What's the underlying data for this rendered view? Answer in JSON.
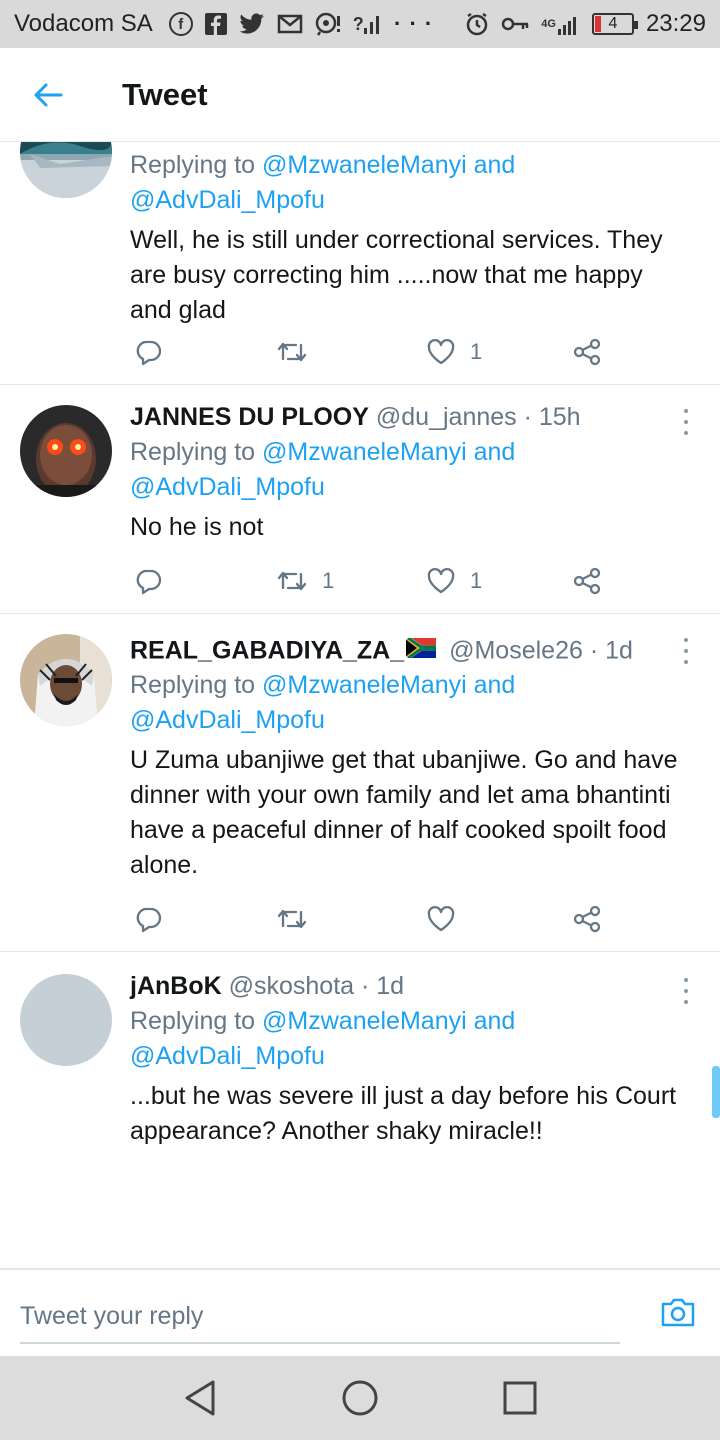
{
  "status_bar": {
    "carrier": "Vodacom SA",
    "signal_text": "?",
    "network_type": "4G",
    "battery_level": "4",
    "time": "23:29"
  },
  "header": {
    "title": "Tweet"
  },
  "tweets": [
    {
      "name": "",
      "handle": "",
      "time": "",
      "replying_prefix": "Replying to ",
      "reply_mention_1": "@MzwaneleManyi",
      "reply_and": " and",
      "reply_mention_2": "@AdvDali_Mpofu",
      "text": "Well, he is still under correctional services. They are busy correcting him .....now that me happy and glad",
      "retweets": "",
      "likes": "1"
    },
    {
      "name": "JANNES DU PLOOY",
      "handle": "@du_jannes",
      "time": "15h",
      "replying_prefix": "Replying to ",
      "reply_mention_1": "@MzwaneleManyi",
      "reply_and": " and",
      "reply_mention_2": "@AdvDali_Mpofu",
      "text": "No he is not",
      "retweets": "1",
      "likes": "1"
    },
    {
      "name": "REAL_GABADIYA_ZA_",
      "handle": "@Mosele26",
      "time": "1d",
      "replying_prefix": "Replying to ",
      "reply_mention_1": "@MzwaneleManyi",
      "reply_and": " and",
      "reply_mention_2": "@AdvDali_Mpofu",
      "text": "U Zuma ubanjiwe get that ubanjiwe. Go and have dinner with your own family and let ama bhantinti have a peaceful dinner of half cooked spoilt food alone.",
      "retweets": "",
      "likes": ""
    },
    {
      "name": "jAnBoK",
      "handle": "@skoshota",
      "time": "1d",
      "replying_prefix": "Replying to ",
      "reply_mention_1": "@MzwaneleManyi",
      "reply_and": " and",
      "reply_mention_2": "@AdvDali_Mpofu",
      "text": "...but he was severe ill just a day before his Court appearance? Another shaky miracle!!"
    }
  ],
  "meta_separator": " · ",
  "compose": {
    "placeholder": "Tweet your reply"
  },
  "colors": {
    "accent": "#1da1f2",
    "secondary_text": "#657786",
    "divider": "#e1e8ed"
  },
  "icons": {
    "back": "arrow-left-icon",
    "reply": "reply-icon",
    "retweet": "retweet-icon",
    "like": "heart-icon",
    "share": "share-icon",
    "more": "more-vertical-icon",
    "camera": "camera-icon"
  }
}
